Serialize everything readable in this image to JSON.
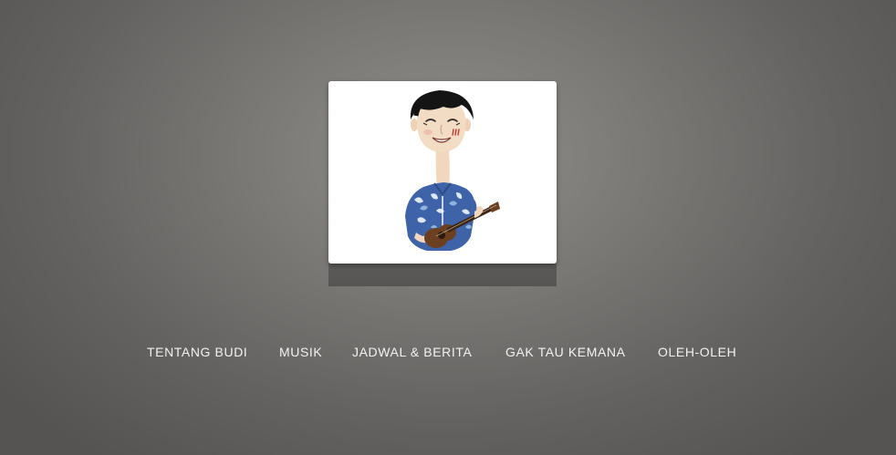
{
  "brand": {
    "logo_icon": "ukulele-player-caricature-icon"
  },
  "nav": {
    "items": [
      {
        "label": "TENTANG BUDI"
      },
      {
        "label": "MUSIK"
      },
      {
        "label": "JADWAL & BERITA"
      },
      {
        "label": "GAK TAU KEMANA"
      },
      {
        "label": "OLEH-OLEH"
      }
    ]
  },
  "colors": {
    "background": "#7a7976",
    "card": "#ffffff",
    "nav_text": "#f2f2f2",
    "shirt": "#3f63a8",
    "ukulele": "#6b3f1f"
  }
}
